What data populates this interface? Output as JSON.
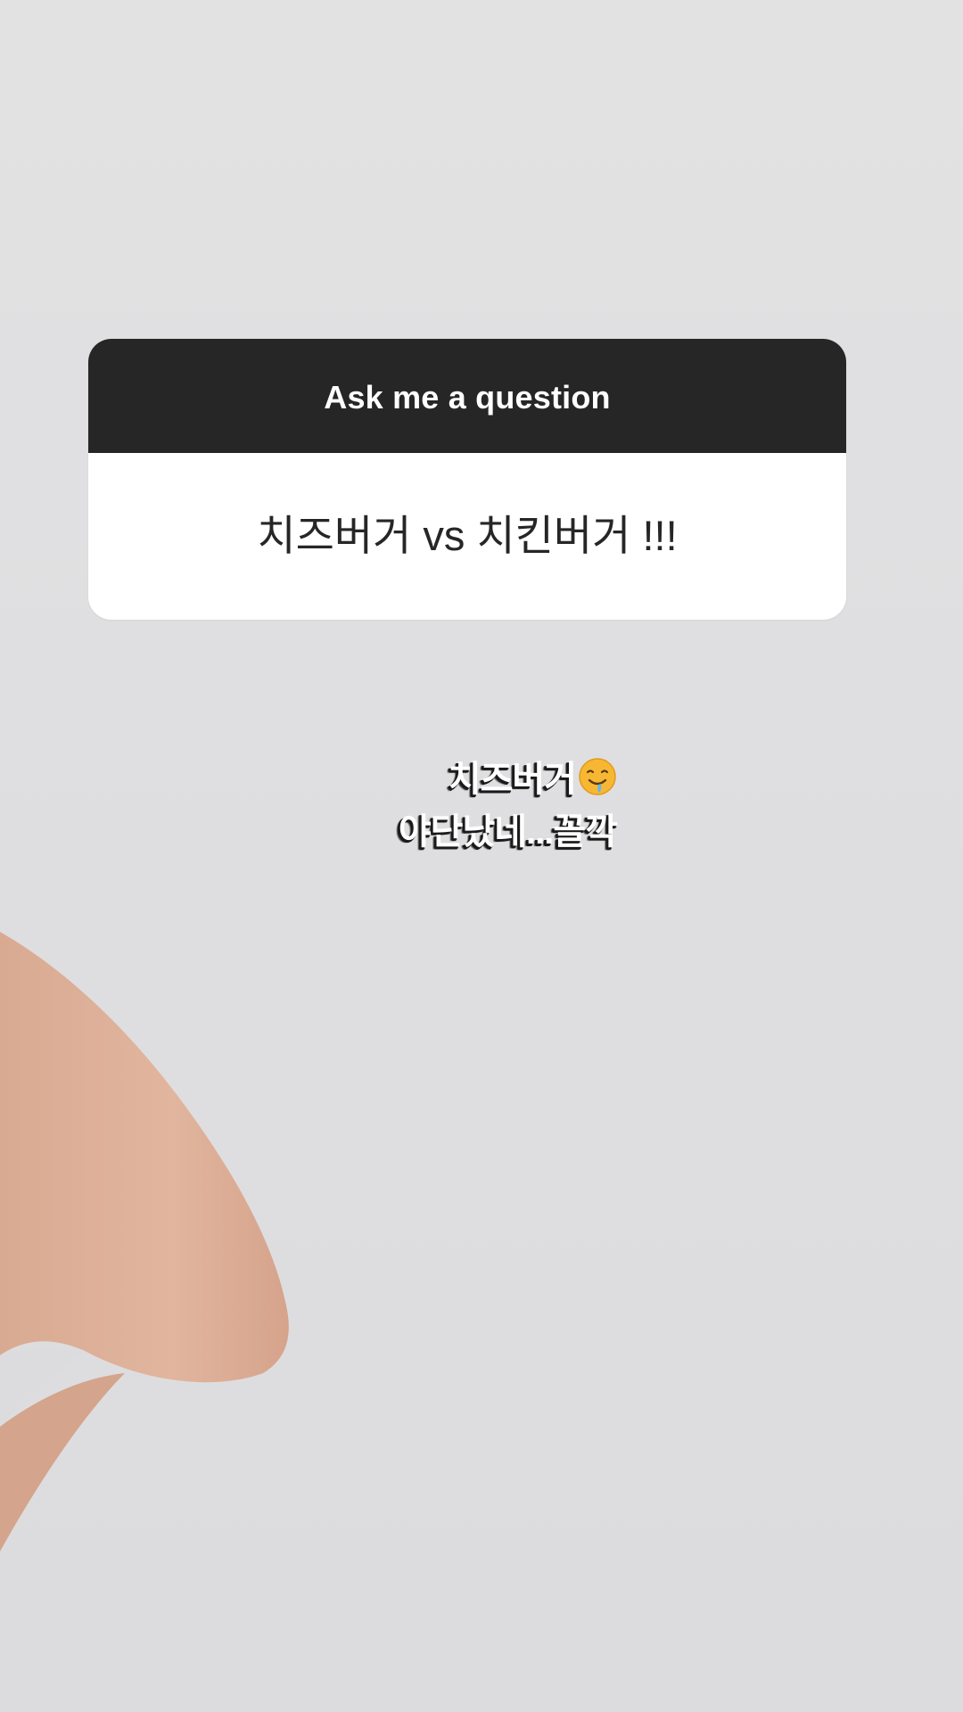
{
  "question_sticker": {
    "header": "Ask me a question",
    "question": "치즈버거 vs 치킨버거 !!!"
  },
  "reply": {
    "line1": "치즈버거",
    "line1_emoji": "drooling-face-icon",
    "line2": "야단났네...꼴깍"
  },
  "colors": {
    "header_bg": "#262626",
    "card_bg": "#ffffff",
    "background": "#e0e0e2",
    "reply_text": "#ffffff"
  }
}
